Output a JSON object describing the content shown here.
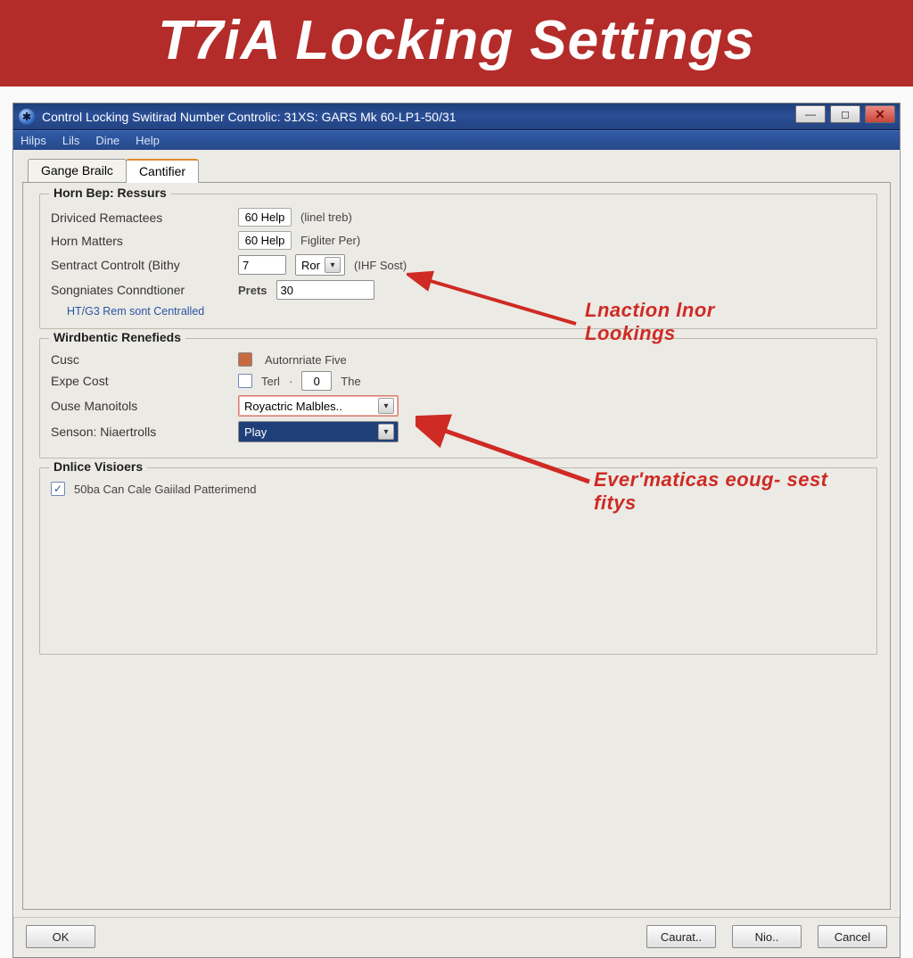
{
  "banner": {
    "title": "T7iA Locking Settings"
  },
  "window": {
    "title": "Control Locking Switirad Number Controlic: 31XS: GARS Mk 60-LP1-50/31"
  },
  "menu": {
    "items": [
      "Hilps",
      "Lils",
      "Dine",
      "Help"
    ]
  },
  "tabs": {
    "items": [
      "Gange Brailc",
      "Cantifier"
    ],
    "active_index": 1
  },
  "group1": {
    "legend": "Horn Bep: Ressurs",
    "rows": {
      "r0": {
        "label": "Driviced Remactees",
        "value": "60 Help",
        "hint": "(linel treb)"
      },
      "r1": {
        "label": "Horn Matters",
        "value": "60 Help",
        "hint": "Figliter Per)"
      },
      "r2": {
        "label": "Sentract Controlt (Bithy",
        "value": "7",
        "combo_hint": "Ror",
        "suffix": "(IHF Sost)"
      },
      "r3": {
        "label": "Songniates Conndtioner",
        "prefix": "Prets",
        "value": "30"
      }
    },
    "subnote": "HT/G3 Rem sont Centralled"
  },
  "group2": {
    "legend": "Wirdbentic Renefieds",
    "rows": {
      "cusc": {
        "label": "Cusc",
        "chk_color": "#c86a3f",
        "chk_text": "Autornriate Five"
      },
      "expe": {
        "label": "Expe Cost",
        "chk_text": "Terl",
        "val": "0",
        "suffix": "The"
      },
      "ouse": {
        "label": "Ouse Manoitols",
        "combo": "Royactric Malbles.."
      },
      "senson": {
        "label": "Senson: Niaertrolls",
        "combo": "Play"
      }
    }
  },
  "group3": {
    "legend": "Dnlice Visioers",
    "chk_label": "50ba Can Cale Gaiilad Patterimend"
  },
  "annotations": {
    "a1": "Lnaction lnor Lookings",
    "a2": "Ever'maticas eoug- sest fitys"
  },
  "buttons": {
    "ok": "OK",
    "caurat": "Caurat..",
    "nio": "Nio..",
    "cancel": "Cancel"
  }
}
